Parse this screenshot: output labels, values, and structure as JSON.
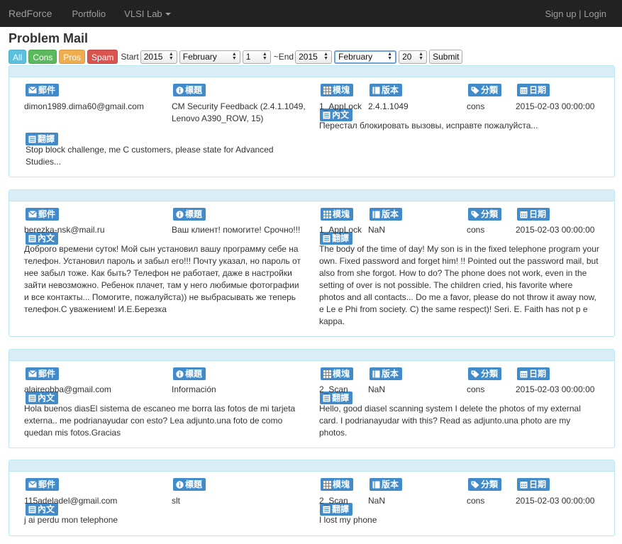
{
  "nav": {
    "brand": "RedForce",
    "portfolio": "Portfolio",
    "vlsi": "VLSI Lab",
    "signup": "Sign up",
    "sep": "|",
    "login": "Login"
  },
  "page_title": "Problem Mail",
  "filters": {
    "all": "All",
    "cons": "Cons",
    "pros": "Pros",
    "spam": "Spam",
    "start_label": "Start",
    "start_year": "2015",
    "start_month": "February",
    "start_day": "1",
    "end_label": "~End",
    "end_year": "2015",
    "end_month": "February",
    "end_day": "20",
    "submit": "Submit"
  },
  "colors": {
    "all": "#5bc0de",
    "cons": "#5cb85c",
    "pros": "#f0ad4e",
    "spam": "#d9534f",
    "label": "#428bca"
  },
  "labels": {
    "mail": "郵件",
    "subject": "標題",
    "module": "模塊",
    "version": "版本",
    "category": "分類",
    "date": "日期",
    "content": "內文",
    "translation": "翻譯"
  },
  "messages": [
    {
      "email": "dimon1989.dima60@gmail.com",
      "subject": "CM Security Feedback (2.4.1.1049, Lenovo A390_ROW, 15)",
      "module": "1_AppLock",
      "version": "2.4.1.1049",
      "category": "cons",
      "date": "2015-02-03 00:00:00",
      "content": "Перестал блокировать вызовы, исправте пожалуйста...",
      "translation": " Stop block challenge, me C customers, please state for Advanced Studies..."
    },
    {
      "email": "berezka-nsk@mail.ru",
      "subject": "Ваш клиент! помогите! Срочно!!!",
      "module": "1_AppLock",
      "version": "NaN",
      "category": "cons",
      "date": "2015-02-03 00:00:00",
      "content": "Доброго времени суток! Мой сын установил вашу программу себе на телефон. Установил пароль и забыл его!!! Почту указал, но пароль от нее забыл тоже. Как быть? Телефон не работает, даже в настройки зайти невозможно. Ребенок плачет, там у него любимые фотографии и все контакты... Помогите, пожалуйста)) не выбрасывать же теперь телефон.С уважением! И.Е.Березка",
      "translation": " The body of the time of day! My son is in the fixed telephone program your own. Fixed password and forget him! !! Pointed out the password mail, but also from she forgot. How to do? The phone does not work, even in the setting of over is not possible. The children cried, his favorite where photos and all contacts... Do me a favor, please do not throw it away now, e Le e Phi from society. C) the same respect)! Seri. E. Faith has not p e kappa."
    },
    {
      "email": "alaireobba@gmail.com",
      "subject": "Información",
      "module": "2_Scan",
      "version": "NaN",
      "category": "cons",
      "date": "2015-02-03 00:00:00",
      "content": "Hola buenos diasEl sistema de escaneo me borra las fotos de mi tarjeta externa.. me podrianayudar con esto? Lea adjunto.una foto de como quedan mis fotos.Gracias",
      "translation": " Hello, good diasel scanning system I delete the photos of my external card. I podrianayudar with this? Read as adjunto.una photo are my photos."
    },
    {
      "email": "115adeladel@gmail.com",
      "subject": "slt",
      "module": "2_Scan",
      "version": "NaN",
      "category": "cons",
      "date": "2015-02-03 00:00:00",
      "content": "j ai perdu mon telephone",
      "translation": " I lost my phone"
    }
  ]
}
